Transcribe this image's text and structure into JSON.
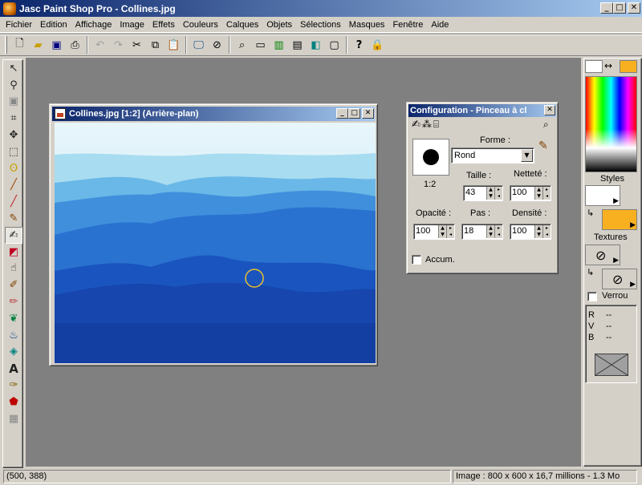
{
  "app": {
    "title": "Jasc Paint Shop Pro - Collines.jpg"
  },
  "menu": [
    "Fichier",
    "Edition",
    "Affichage",
    "Image",
    "Effets",
    "Couleurs",
    "Calques",
    "Objets",
    "Sélections",
    "Masques",
    "Fenêtre",
    "Aide"
  ],
  "toolbar": {
    "buttons": [
      "new-file-icon",
      "open-folder-icon",
      "save-icon",
      "print-icon",
      "undo-icon",
      "redo-icon",
      "cut-icon",
      "copy-icon",
      "paste-icon",
      "monitor-icon",
      "zoom-fit-icon",
      "overview-icon",
      "toolbar-toggle-icon",
      "color-histogram-icon",
      "histogram-icon",
      "layers-icon",
      "window-icon",
      "context-help-icon",
      "lock-icon"
    ]
  },
  "tools": [
    "arrow-icon",
    "zoom-icon",
    "deform-icon",
    "crop-icon",
    "move-icon",
    "selection-icon",
    "lasso-icon",
    "dropper-icon",
    "clone-brush-icon",
    "paintbrush-icon",
    "clone-icon",
    "color-replace-icon",
    "retouch-icon",
    "scratch-remover-icon",
    "eraser-icon",
    "picture-tube-icon",
    "airbrush-icon",
    "flood-fill-icon",
    "text-icon",
    "draw-icon",
    "preset-shapes-icon",
    "object-selector-icon"
  ],
  "image_window": {
    "title": "Collines.jpg [1:2] (Arrière-plan)"
  },
  "config_palette": {
    "title": "Configuration - Pinceau à cl",
    "forme_label": "Forme :",
    "forme_value": "Rond",
    "scale": "1:2",
    "taille_label": "Taille :",
    "taille_value": "43",
    "nettete_label": "Netteté :",
    "nettete_value": "100",
    "opacite_label": "Opacité :",
    "opacite_value": "100",
    "pas_label": "Pas :",
    "pas_value": "18",
    "densite_label": "Densité :",
    "densite_value": "100",
    "accum_label": "Accum."
  },
  "right_panel": {
    "styles_label": "Styles",
    "textures_label": "Textures",
    "verrou_label": "Verrou",
    "r_label": "R",
    "r_value": "--",
    "v_label": "V",
    "v_value": "--",
    "b_label": "B",
    "b_value": "--",
    "accent_color": "#f8b020"
  },
  "status": {
    "coords": "(500, 388)",
    "image_info": "Image :  800 x 600 x 16,7 millions - 1.3 Mo"
  }
}
